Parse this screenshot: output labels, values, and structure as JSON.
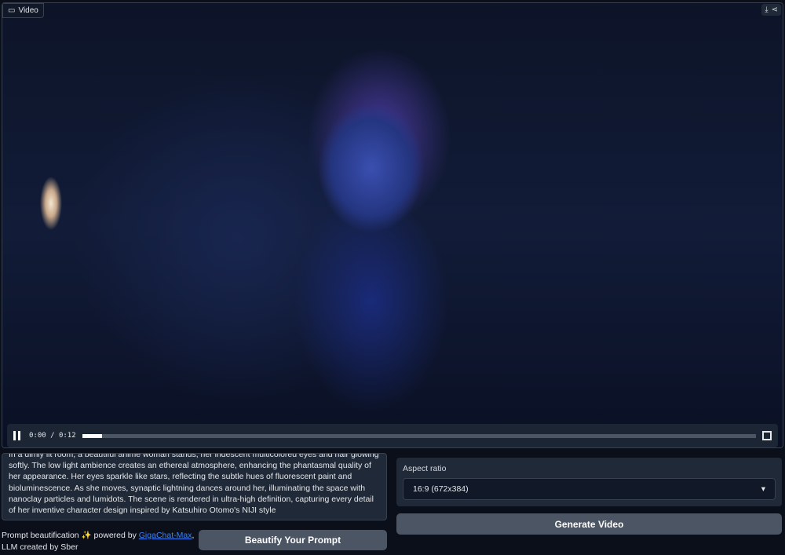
{
  "video": {
    "label": "Video",
    "label_icon": "video-camera-icon",
    "actions": [
      "download-icon",
      "share-icon"
    ],
    "current_time": "0:00",
    "duration": "0:12",
    "progress_percent": 3,
    "playing": true
  },
  "prompt": {
    "text": "In a dimly lit room, a beautiful anime woman stands, her iridescent multicolored eyes and hair glowing softly. The low light ambience creates an ethereal atmosphere, enhancing the phantasmal quality of her appearance. Her eyes sparkle like stars, reflecting the subtle hues of fluorescent paint and bioluminescence. As she moves, synaptic lightning dances around her, illuminating the space with nanoclay particles and lumidots. The scene is rendered in ultra-high definition, capturing every detail of her inventive character design inspired by Katsuhiro Otomo's NIJI style"
  },
  "aspect": {
    "label": "Aspect ratio",
    "value": "16:9 (672x384)"
  },
  "buttons": {
    "generate": "Generate Video",
    "beautify": "Beautify Your Prompt"
  },
  "credit": {
    "prefix": "Prompt beautification",
    "sparkle": "✨",
    "mid": " powered by ",
    "link": "GigaChat-Max",
    "suffix": ",",
    "line2": "LLM created by Sber"
  }
}
